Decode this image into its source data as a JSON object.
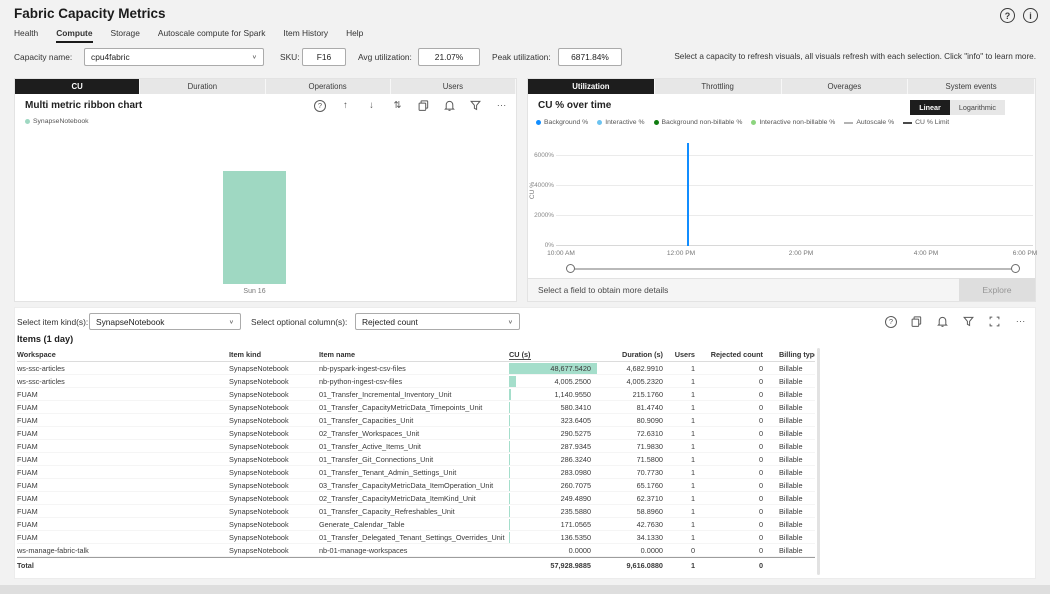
{
  "header": {
    "title": "Fabric Capacity Metrics",
    "help_label": "?",
    "info_label": "i"
  },
  "icons": {
    "help": "?",
    "drill_up": "↑",
    "drill_down": "↓",
    "expand": "⇅",
    "more": "···",
    "chevron": "∨"
  },
  "nav": {
    "tabs": [
      "Health",
      "Compute",
      "Storage",
      "Autoscale compute for Spark",
      "Item History",
      "Help"
    ],
    "active": "Compute"
  },
  "filters": {
    "capacity": {
      "label": "Capacity name:",
      "value": "cpu4fabric"
    },
    "sku": {
      "label": "SKU:",
      "value": "F16"
    },
    "avg": {
      "label": "Avg utilization:",
      "value": "21.07%"
    },
    "peak": {
      "label": "Peak utilization:",
      "value": "6871.84%"
    },
    "note": "Select a capacity to refresh visuals, all visuals refresh with each selection. Click \"info\" to learn more."
  },
  "left_panel": {
    "tabs": [
      "CU",
      "Duration",
      "Operations",
      "Users"
    ],
    "active_tab": "CU",
    "title": "Multi metric ribbon chart",
    "legend": [
      {
        "label": "SynapseNotebook",
        "color": "#9fd8c2",
        "marker": "dot"
      }
    ],
    "x_label": "Sun 16",
    "chart_data": {
      "type": "bar",
      "title": "Multi metric ribbon chart",
      "categories": [
        "Sun 16"
      ],
      "series": [
        {
          "name": "SynapseNotebook",
          "values": [
            57928.9885
          ]
        }
      ],
      "bar_color": "#9fd8c2"
    }
  },
  "right_panel": {
    "tabs": [
      "Utilization",
      "Throttling",
      "Overages",
      "System events"
    ],
    "active_tab": "Utilization",
    "title": "CU % over time",
    "scale_buttons": {
      "linear": "Linear",
      "log": "Logarithmic",
      "active": "Linear"
    },
    "y_axis_label": "CU %",
    "footer": {
      "prompt": "Select a field to obtain more details",
      "explore_label": "Explore"
    },
    "chart_data": {
      "type": "line",
      "title": "CU % over time",
      "x_ticks": [
        "10:00 AM",
        "12:00 PM",
        "2:00 PM",
        "4:00 PM",
        "6:00 PM"
      ],
      "y_ticks": [
        "0%",
        "2000%",
        "4000%",
        "6000%"
      ],
      "ylim": [
        0,
        7000
      ],
      "series": [
        {
          "name": "Background %",
          "color": "#118DFF",
          "points": [
            [
              "10:00 AM",
              0
            ],
            [
              "12:40 PM",
              0
            ],
            [
              "12:45 PM",
              6872
            ],
            [
              "12:50 PM",
              0
            ],
            [
              "6:00 PM",
              0
            ]
          ]
        }
      ],
      "legend": [
        {
          "label": "Background %",
          "color": "#118DFF",
          "marker": "dot"
        },
        {
          "label": "Interactive %",
          "color": "#6cc3f0",
          "marker": "dot"
        },
        {
          "label": "Background non-billable %",
          "color": "#107C10",
          "marker": "dot"
        },
        {
          "label": "Interactive non-billable %",
          "color": "#8cd47e",
          "marker": "dot"
        },
        {
          "label": "Autoscale %",
          "color": "#b3b3b3",
          "marker": "line"
        },
        {
          "label": "CU % Limit",
          "color": "#4a4a4a",
          "marker": "line"
        }
      ]
    }
  },
  "items_panel": {
    "item_kind": {
      "label": "Select item kind(s):",
      "value": "SynapseNotebook"
    },
    "optional_column": {
      "label": "Select optional column(s):",
      "value": "Rejected count"
    },
    "table": {
      "title": "Items (1 day)",
      "bar_color": "#a5decb",
      "columns": [
        "Workspace",
        "Item kind",
        "Item name",
        "CU (s)",
        "Duration (s)",
        "Users",
        "Rejected count",
        "Billing type"
      ],
      "sorted_column": "CU (s)",
      "rows": [
        [
          "ws-ssc-articles",
          "SynapseNotebook",
          "nb-pyspark-ingest-csv-files",
          "48,677.5420",
          "4,682.9910",
          "1",
          "0",
          "Billable"
        ],
        [
          "ws-ssc-articles",
          "SynapseNotebook",
          "nb-python-ingest-csv-files",
          "4,005.2500",
          "4,005.2320",
          "1",
          "0",
          "Billable"
        ],
        [
          "FUAM",
          "SynapseNotebook",
          "01_Transfer_Incremental_Inventory_Unit",
          "1,140.9550",
          "215.1760",
          "1",
          "0",
          "Billable"
        ],
        [
          "FUAM",
          "SynapseNotebook",
          "01_Transfer_CapacityMetricData_Timepoints_Unit",
          "580.3410",
          "81.4740",
          "1",
          "0",
          "Billable"
        ],
        [
          "FUAM",
          "SynapseNotebook",
          "01_Transfer_Capacities_Unit",
          "323.6405",
          "80.9090",
          "1",
          "0",
          "Billable"
        ],
        [
          "FUAM",
          "SynapseNotebook",
          "02_Transfer_Workspaces_Unit",
          "290.5275",
          "72.6310",
          "1",
          "0",
          "Billable"
        ],
        [
          "FUAM",
          "SynapseNotebook",
          "01_Transfer_Active_Items_Unit",
          "287.9345",
          "71.9830",
          "1",
          "0",
          "Billable"
        ],
        [
          "FUAM",
          "SynapseNotebook",
          "01_Transfer_Git_Connections_Unit",
          "286.3240",
          "71.5800",
          "1",
          "0",
          "Billable"
        ],
        [
          "FUAM",
          "SynapseNotebook",
          "01_Transfer_Tenant_Admin_Settings_Unit",
          "283.0980",
          "70.7730",
          "1",
          "0",
          "Billable"
        ],
        [
          "FUAM",
          "SynapseNotebook",
          "03_Transfer_CapacityMetricData_ItemOperation_Unit",
          "260.7075",
          "65.1760",
          "1",
          "0",
          "Billable"
        ],
        [
          "FUAM",
          "SynapseNotebook",
          "02_Transfer_CapacityMetricData_ItemKind_Unit",
          "249.4890",
          "62.3710",
          "1",
          "0",
          "Billable"
        ],
        [
          "FUAM",
          "SynapseNotebook",
          "01_Transfer_Capacity_Refreshables_Unit",
          "235.5880",
          "58.8960",
          "1",
          "0",
          "Billable"
        ],
        [
          "FUAM",
          "SynapseNotebook",
          "Generate_Calendar_Table",
          "171.0565",
          "42.7630",
          "1",
          "0",
          "Billable"
        ],
        [
          "FUAM",
          "SynapseNotebook",
          "01_Transfer_Delegated_Tenant_Settings_Overrides_Unit",
          "136.5350",
          "34.1330",
          "1",
          "0",
          "Billable"
        ],
        [
          "ws-manage-fabric-talk",
          "SynapseNotebook",
          "nb-01-manage-workspaces",
          "0.0000",
          "0.0000",
          "0",
          "0",
          "Billable"
        ]
      ],
      "total": [
        "Total",
        "",
        "",
        "57,928.9885",
        "9,616.0880",
        "1",
        "0",
        ""
      ]
    }
  }
}
